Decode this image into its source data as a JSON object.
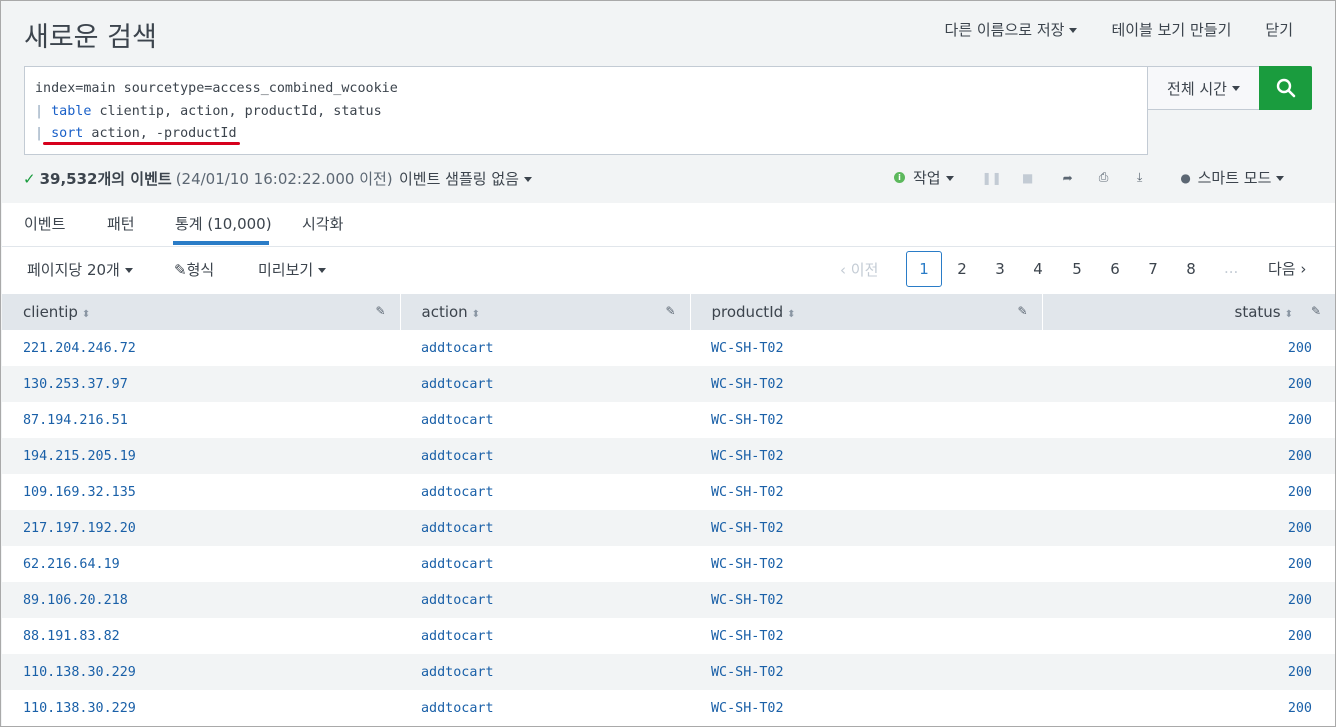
{
  "header": {
    "title": "새로운 검색",
    "save_as": "다른 이름으로 저장",
    "create_table_view": "테이블 보기 만들기",
    "close": "닫기"
  },
  "search": {
    "line1": "index=main sourcetype=access_combined_wcookie",
    "line2_pipe": "|",
    "line2_cmd": "table",
    "line2_args": " clientip, action, productId, status",
    "line3_pipe": "|",
    "line3_cmd": "sort",
    "line3_args": " action, -productId",
    "time_range": "전체 시간",
    "underline_color": "#d6001c"
  },
  "status": {
    "check": "✓",
    "count": "39,532개의 이벤트",
    "since": "(24/01/10 16:02:22.000 이전)",
    "sampling": "이벤트 샘플링 없음",
    "job": "작업",
    "smart_mode": "스마트 모드"
  },
  "tabs": [
    {
      "label": "이벤트"
    },
    {
      "label": "패턴"
    },
    {
      "label": "통계 (10,000)"
    },
    {
      "label": "시각화"
    }
  ],
  "table_options": {
    "per_page": "페이지당 20개",
    "format": "형식",
    "preview": "미리보기"
  },
  "pagination": {
    "prev": "이전",
    "pages": [
      "1",
      "2",
      "3",
      "4",
      "5",
      "6",
      "7",
      "8"
    ],
    "current": "1",
    "ellipsis": "...",
    "next": "다음"
  },
  "table": {
    "columns": [
      "clientip",
      "action",
      "productId",
      "status"
    ],
    "rows": [
      [
        "221.204.246.72",
        "addtocart",
        "WC-SH-T02",
        "200"
      ],
      [
        "130.253.37.97",
        "addtocart",
        "WC-SH-T02",
        "200"
      ],
      [
        "87.194.216.51",
        "addtocart",
        "WC-SH-T02",
        "200"
      ],
      [
        "194.215.205.19",
        "addtocart",
        "WC-SH-T02",
        "200"
      ],
      [
        "109.169.32.135",
        "addtocart",
        "WC-SH-T02",
        "200"
      ],
      [
        "217.197.192.20",
        "addtocart",
        "WC-SH-T02",
        "200"
      ],
      [
        "62.216.64.19",
        "addtocart",
        "WC-SH-T02",
        "200"
      ],
      [
        "89.106.20.218",
        "addtocart",
        "WC-SH-T02",
        "200"
      ],
      [
        "88.191.83.82",
        "addtocart",
        "WC-SH-T02",
        "200"
      ],
      [
        "110.138.30.229",
        "addtocart",
        "WC-SH-T02",
        "200"
      ],
      [
        "110.138.30.229",
        "addtocart",
        "WC-SH-T02",
        "200"
      ]
    ]
  },
  "colors": {
    "search_button": "#1a9c3e",
    "link": "#1a60a8",
    "active_tab": "#2a7cc7"
  }
}
